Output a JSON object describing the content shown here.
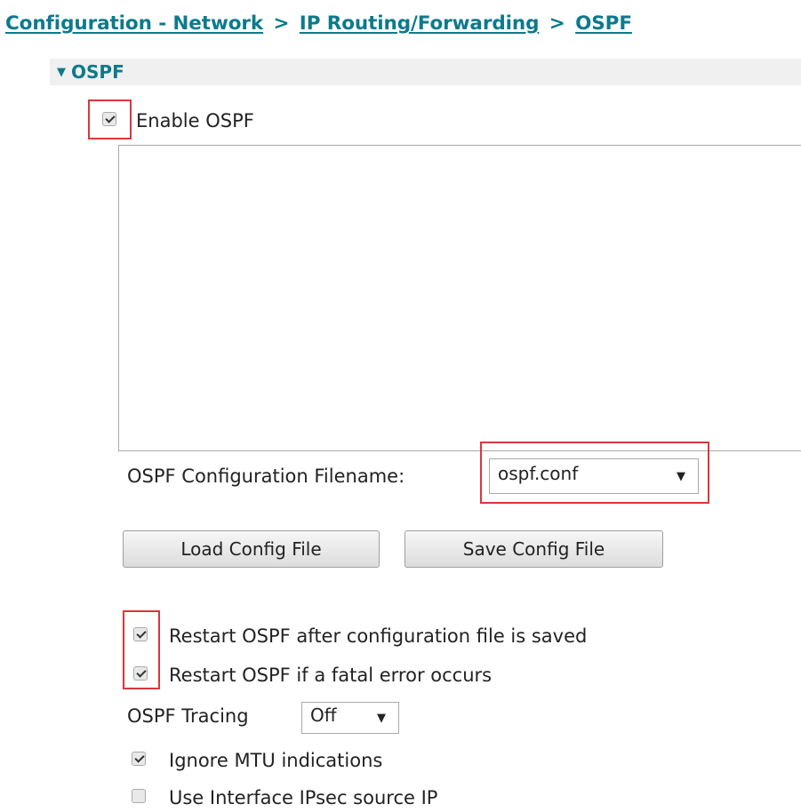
{
  "breadcrumb": {
    "items": [
      "Configuration - Network",
      "IP Routing/Forwarding",
      "OSPF"
    ],
    "separator": ">"
  },
  "section": {
    "title": "OSPF",
    "expanded": true
  },
  "enable_ospf": {
    "label": "Enable OSPF",
    "checked": true
  },
  "config_editor": {
    "value": ""
  },
  "filename": {
    "label": "OSPF Configuration Filename:",
    "selected": "ospf.conf"
  },
  "buttons": {
    "load": "Load Config File",
    "save": "Save Config File"
  },
  "options": {
    "restart_after_save": {
      "label": "Restart OSPF after configuration file is saved",
      "checked": true
    },
    "restart_on_fatal": {
      "label": "Restart OSPF if a fatal error occurs",
      "checked": true
    }
  },
  "tracing": {
    "label": "OSPF Tracing",
    "selected": "Off"
  },
  "ignore_mtu": {
    "label": "Ignore MTU indications",
    "checked": true
  },
  "ipsec_source": {
    "label": "Use Interface IPsec source IP",
    "checked": false
  },
  "colors": {
    "link": "#0d7a8c",
    "highlight": "#d9373b",
    "header_bg": "#f0f0f0"
  },
  "icons": {
    "expand": "caret-down-icon",
    "dropdown": "dropdown-arrow-icon"
  }
}
